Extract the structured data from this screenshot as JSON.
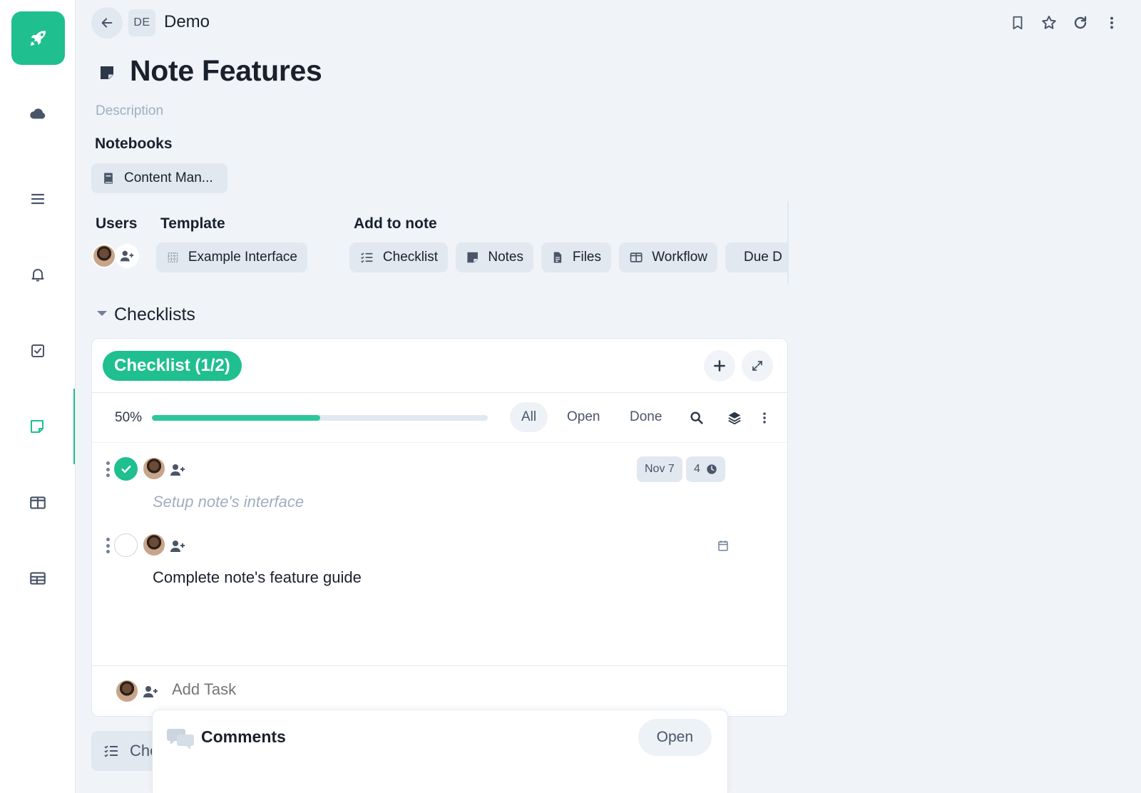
{
  "colors": {
    "accent": "#1fbf8f",
    "muted": "#a0aec0",
    "chip_bg": "#e2e8f0"
  },
  "header": {
    "workspace_badge": "DE",
    "workspace_name": "Demo",
    "actions": [
      "bookmark-icon",
      "star-icon",
      "refresh-icon",
      "more-vertical-icon"
    ]
  },
  "sidebar": {
    "logo_icon": "rocket-icon",
    "items": [
      {
        "icon": "cloud-icon",
        "active": false
      },
      {
        "icon": "menu-icon",
        "active": false
      },
      {
        "icon": "bell-icon",
        "active": false
      },
      {
        "icon": "checkbox-icon",
        "active": false
      },
      {
        "icon": "note-icon",
        "active": true
      },
      {
        "icon": "columns-icon",
        "active": false
      },
      {
        "icon": "table-icon",
        "active": false
      }
    ]
  },
  "note": {
    "title": "Note Features",
    "description_placeholder": "Description",
    "notebooks_label": "Notebooks",
    "notebook": "Content Man...",
    "users_label": "Users",
    "template_label": "Template",
    "template_value": "Example Interface",
    "add_to_note_label": "Add to note",
    "add_to_note": [
      {
        "label": "Checklist",
        "icon": "checklist-icon"
      },
      {
        "label": "Notes",
        "icon": "note-icon"
      },
      {
        "label": "Files",
        "icon": "file-icon"
      },
      {
        "label": "Workflow",
        "icon": "columns-icon"
      },
      {
        "label": "Due D",
        "icon": "calendar-icon"
      }
    ]
  },
  "checklists": {
    "section_title": "Checklists",
    "checklist_label": "Checklist (1/2)",
    "progress_text": "50%",
    "progress_fraction": 0.5,
    "filters": [
      "All",
      "Open",
      "Done"
    ],
    "active_filter": "All",
    "tasks": [
      {
        "text": "Setup note's interface",
        "done": true,
        "date": "Nov 7",
        "count": "4"
      },
      {
        "text": "Complete note's feature guide",
        "done": false
      }
    ],
    "add_task_placeholder": "Add Task"
  },
  "bottom": {
    "chip_label": "Che",
    "comments_title": "Comments",
    "comments_open": "Open"
  }
}
